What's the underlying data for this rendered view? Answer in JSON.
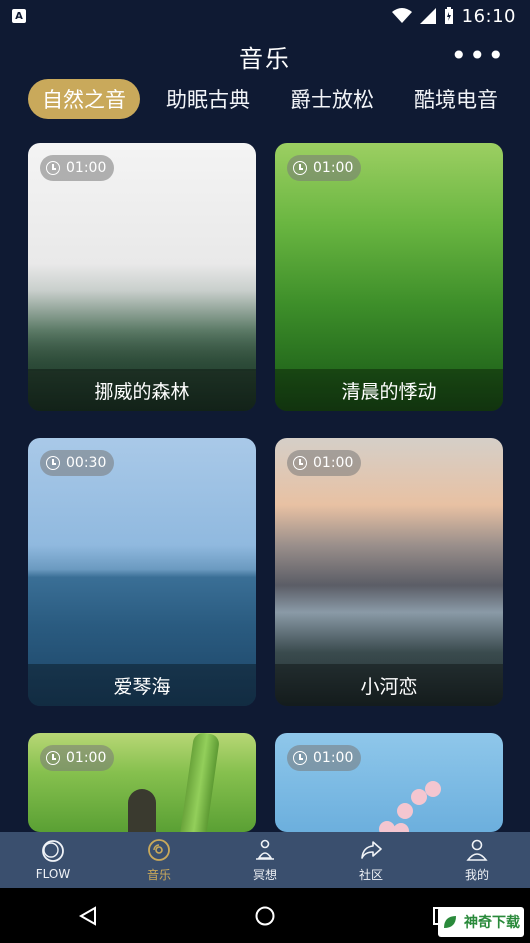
{
  "status_bar": {
    "time": "16:10",
    "left_icon": "A"
  },
  "header": {
    "title": "音乐",
    "more": "•••"
  },
  "tabs": [
    {
      "label": "自然之音",
      "active": true
    },
    {
      "label": "助眠古典",
      "active": false
    },
    {
      "label": "爵士放松",
      "active": false
    },
    {
      "label": "酷境电音",
      "active": false
    }
  ],
  "cards": [
    {
      "duration": "01:00",
      "title": "挪威的森林",
      "theme": "forest"
    },
    {
      "duration": "01:00",
      "title": "清晨的悸动",
      "theme": "grass"
    },
    {
      "duration": "00:30",
      "title": "爱琴海",
      "theme": "sea"
    },
    {
      "duration": "01:00",
      "title": "小河恋",
      "theme": "river"
    },
    {
      "duration": "01:00",
      "title": "",
      "theme": "butterfly"
    },
    {
      "duration": "01:00",
      "title": "",
      "theme": "blossom"
    }
  ],
  "bottom_tabs": [
    {
      "label": "FLOW",
      "icon": "flow-circle-icon",
      "active": false
    },
    {
      "label": "音乐",
      "icon": "disc-icon",
      "active": true
    },
    {
      "label": "冥想",
      "icon": "meditation-icon",
      "active": false
    },
    {
      "label": "社区",
      "icon": "share-arrow-icon",
      "active": false
    },
    {
      "label": "我的",
      "icon": "person-icon",
      "active": false
    }
  ],
  "watermark": {
    "text": "神奇下载"
  },
  "colors": {
    "background": "#0f1a33",
    "accent": "#c9a95b",
    "tabbar": "#3a4f6e"
  }
}
